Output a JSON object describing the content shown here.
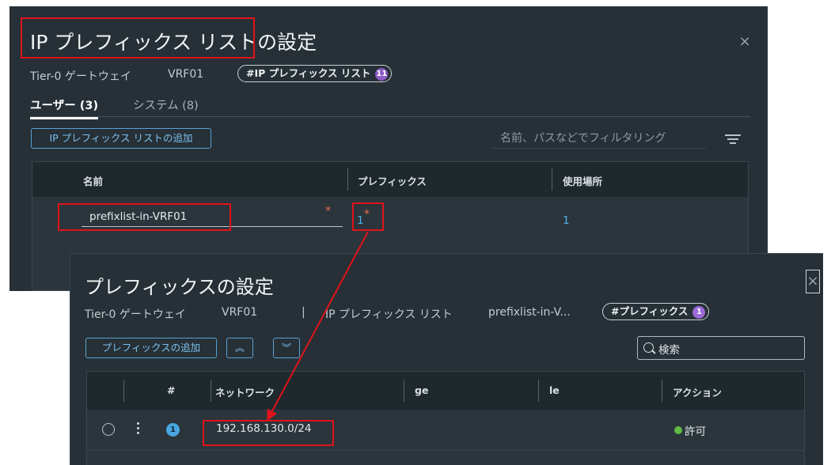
{
  "dialog1": {
    "title": "IP プレフィックス リストの設定",
    "close": "×",
    "breadcrumb": {
      "gateway": "Tier-0 ゲートウェイ",
      "vrf": "VRF01"
    },
    "badge": {
      "label": "#IP プレフィックス リスト",
      "count": "11"
    },
    "tabs": [
      {
        "label": "ユーザー (3)"
      },
      {
        "label": "システム (8)"
      }
    ],
    "add_button": "IP プレフィックス リストの追加",
    "filter_placeholder": "名前、パスなどでフィルタリング",
    "table": {
      "headers": [
        "名前",
        "プレフィックス",
        "使用場所"
      ],
      "row": {
        "name": "prefixlist-in-VRF01",
        "required_mark": "*",
        "prefixes": "1",
        "prefixes_mark": "*",
        "used_in": "1"
      }
    }
  },
  "dialog2": {
    "title": "プレフィックスの設定",
    "close": "×",
    "breadcrumb": {
      "gateway": "Tier-0 ゲートウェイ",
      "vrf": "VRF01",
      "separator": "|",
      "list_label": "IP プレフィックス リスト",
      "list_name": "prefixlist-in-V..."
    },
    "badge": {
      "label": "#プレフィックス",
      "count": "1"
    },
    "add_button": "プレフィックスの追加",
    "move_up_glyph": "︽",
    "move_down_glyph": "︾",
    "search_placeholder": "検索",
    "table": {
      "headers": [
        "#",
        "ネットワーク",
        "ge",
        "le",
        "アクション"
      ],
      "row": {
        "number": "1",
        "network": "192.168.130.0/24",
        "ge": "",
        "le": "",
        "action": "許可"
      }
    }
  },
  "colors": {
    "dialog_bg": "#263036",
    "header_bg": "#1f282d",
    "accent_blue": "#4fb0ec",
    "badge_purple": "#8c5bc4",
    "highlight_red": "#e0131b",
    "allow_green": "#62b946",
    "required_orange": "#f06c4f"
  }
}
